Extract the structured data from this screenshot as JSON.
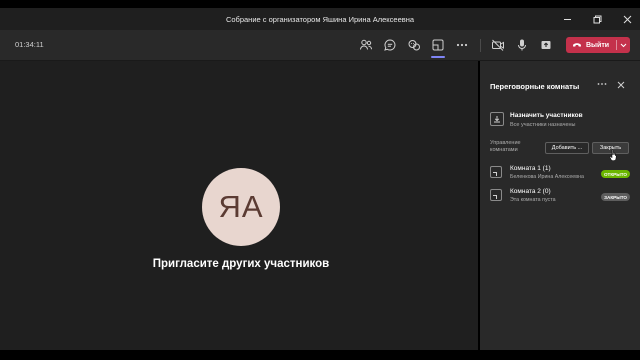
{
  "window": {
    "title": "Собрание с организатором Яшина Ирина Алексеевна",
    "minimize_icon": "minimize-icon",
    "restore_icon": "restore-icon",
    "close_icon": "close-icon"
  },
  "toolbar": {
    "timer": "01:34:11",
    "icons": [
      "people-icon",
      "chat-icon",
      "reactions-icon",
      "breakout-rooms-icon",
      "more-icon",
      "camera-off-icon",
      "mic-icon",
      "share-icon"
    ],
    "leave_label": "Выйти",
    "leave_color": "#c4314b",
    "active_accent": "#7f85f5"
  },
  "stage": {
    "avatar_initials": "ЯА",
    "avatar_bg": "#e8d6cf",
    "invite_text": "Пригласите других участников"
  },
  "panel": {
    "title": "Переговорные комнаты",
    "assign_title": "Назначить участников",
    "assign_subtitle": "Все участники назначены",
    "manage_label": "Управление комнатами",
    "add_button": "Добавить ...",
    "close_button": "Закрыть",
    "rooms": [
      {
        "name": "Комната 1 (1)",
        "subtitle": "Беленкова Ирина Алексеевна",
        "status": "ОТКРЫТО",
        "status_color": "#6bb700"
      },
      {
        "name": "Комната 2 (0)",
        "subtitle": "Эта комната пуста",
        "status": "ЗАКРЫТО",
        "status_color": "#5d5d5d"
      }
    ]
  }
}
